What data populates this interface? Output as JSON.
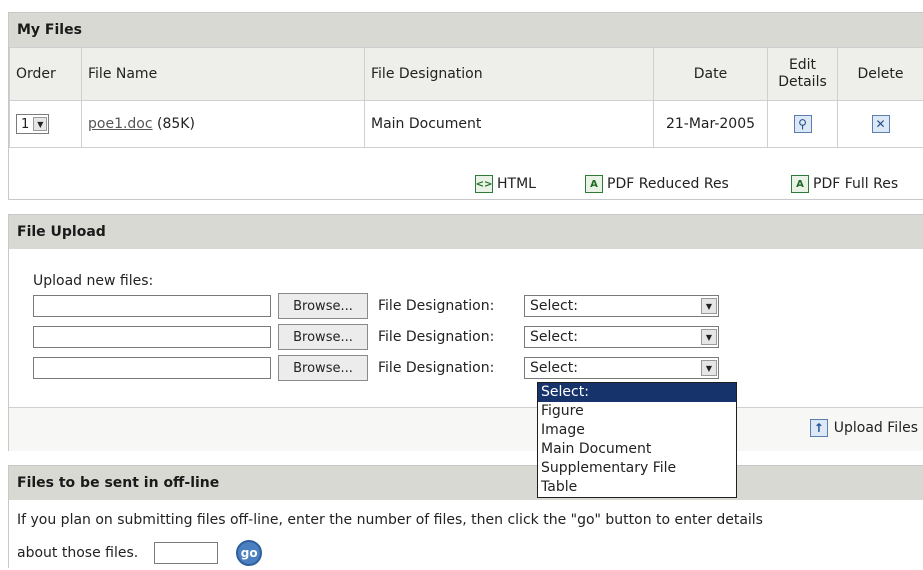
{
  "my_files": {
    "title": "My Files",
    "columns": {
      "order": "Order",
      "file_name": "File Name",
      "designation": "File Designation",
      "date": "Date",
      "edit": "Edit Details",
      "delete": "Delete"
    },
    "rows": [
      {
        "order": "1",
        "file_link": "poe1.doc",
        "size": "(85K)",
        "designation": "Main Document",
        "date": "21-Mar-2005"
      }
    ],
    "formats": {
      "html": "HTML",
      "pdf_reduced": "PDF Reduced Res",
      "pdf_full": "PDF Full Res"
    }
  },
  "file_upload": {
    "title": "File Upload",
    "prompt": "Upload new files:",
    "browse_label": "Browse...",
    "designation_label": "File Designation:",
    "select_value": "Select:",
    "options": [
      "Select:",
      "Figure",
      "Image",
      "Main Document",
      "Supplementary File",
      "Table"
    ],
    "upload_label": "Upload Files"
  },
  "offline": {
    "title": "Files to be sent in off-line",
    "text_line1": "If you plan on submitting files off-line, enter the number of files, then click the \"go\" button to enter details",
    "text_line2": "about those files.",
    "go_label": "go"
  },
  "colors": {
    "header_bg": "#d9d9d3",
    "dropdown_highlight": "#17336b",
    "icon_blue": "#1f4f8c"
  }
}
